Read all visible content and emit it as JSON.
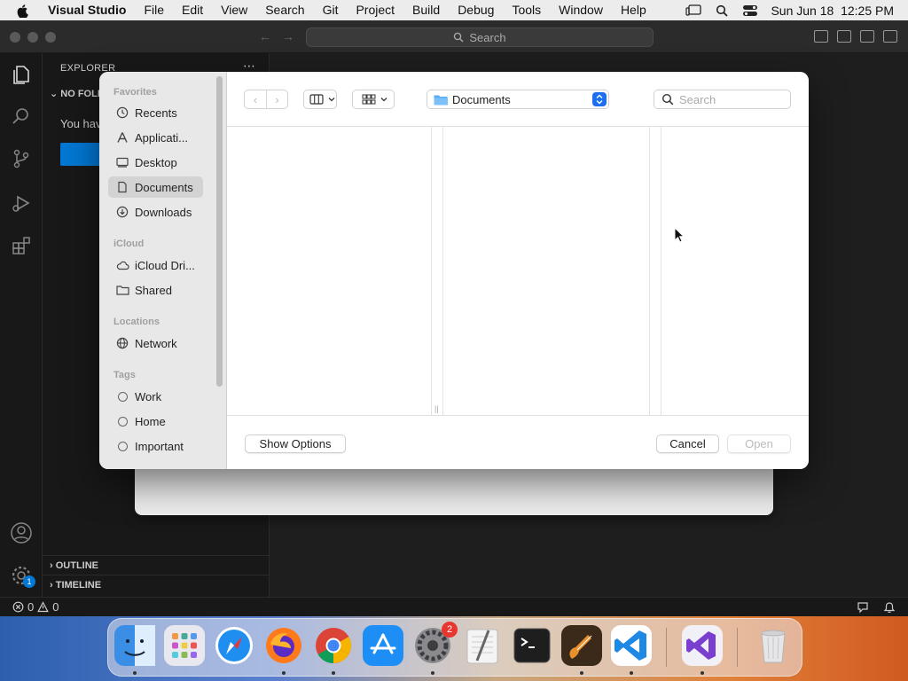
{
  "menubar": {
    "app_name": "Visual Studio",
    "items": [
      "File",
      "Edit",
      "View",
      "Search",
      "Git",
      "Project",
      "Build",
      "Debug",
      "Tools",
      "Window",
      "Help"
    ],
    "clock": "Sun Jun 18  12:25 PM"
  },
  "titlebar": {
    "search_label": "Search"
  },
  "explorer": {
    "title": "EXPLORER",
    "no_folder": "NO FOLI",
    "message": "You hav",
    "outline": "OUTLINE",
    "timeline": "TIMELINE"
  },
  "statusbar": {
    "errors": "0",
    "warnings": "0"
  },
  "activity": {
    "settings_badge": "1"
  },
  "dialog": {
    "sections": {
      "favorites": "Favorites",
      "icloud": "iCloud",
      "locations": "Locations",
      "tags": "Tags"
    },
    "favorites": [
      {
        "label": "Recents",
        "icon": "clock-icon"
      },
      {
        "label": "Applicati...",
        "icon": "applications-icon"
      },
      {
        "label": "Desktop",
        "icon": "desktop-icon"
      },
      {
        "label": "Documents",
        "icon": "document-icon",
        "selected": true
      },
      {
        "label": "Downloads",
        "icon": "download-icon"
      }
    ],
    "icloud": [
      {
        "label": "iCloud Dri...",
        "icon": "cloud-icon"
      },
      {
        "label": "Shared",
        "icon": "shared-folder-icon"
      }
    ],
    "locations": [
      {
        "label": "Network",
        "icon": "globe-icon"
      }
    ],
    "tags": [
      "Work",
      "Home",
      "Important"
    ],
    "location_popup": "Documents",
    "search_placeholder": "Search",
    "show_options": "Show Options",
    "cancel": "Cancel",
    "open": "Open"
  },
  "dock": {
    "apps": [
      {
        "name": "Finder",
        "icon": "finder-icon",
        "color": "#3a8ee6"
      },
      {
        "name": "Launchpad",
        "icon": "launchpad-icon",
        "color": "#e8e8ee"
      },
      {
        "name": "Safari",
        "icon": "safari-icon",
        "color": "#1f8ef1"
      },
      {
        "name": "Firefox",
        "icon": "firefox-icon",
        "color": "#ff7a1a"
      },
      {
        "name": "Chrome",
        "icon": "chrome-icon",
        "color": "#ffffff"
      },
      {
        "name": "App Store",
        "icon": "app-store-icon",
        "color": "#1c8ef5"
      },
      {
        "name": "System Settings",
        "icon": "system-settings-icon",
        "color": "#8a8a8e",
        "badge": "2"
      },
      {
        "name": "TextEdit",
        "icon": "textedit-icon",
        "color": "#f4f4f4"
      },
      {
        "name": "Terminal",
        "icon": "terminal-icon",
        "color": "#1e1e1e"
      },
      {
        "name": "GarageBand",
        "icon": "garageband-icon",
        "color": "#3b2a1a"
      },
      {
        "name": "Visual Studio Code",
        "icon": "vscode-icon",
        "color": "#ffffff"
      },
      {
        "name": "Visual Studio",
        "icon": "visual-studio-icon",
        "color": "#f2f0f7"
      },
      {
        "name": "Trash",
        "icon": "trash-icon",
        "color": "#e6e6e8"
      }
    ]
  },
  "colors": {
    "accent_blue": "#0078d4",
    "dialog_stepper": "#1d6ff0",
    "badge_red": "#e8352d"
  }
}
